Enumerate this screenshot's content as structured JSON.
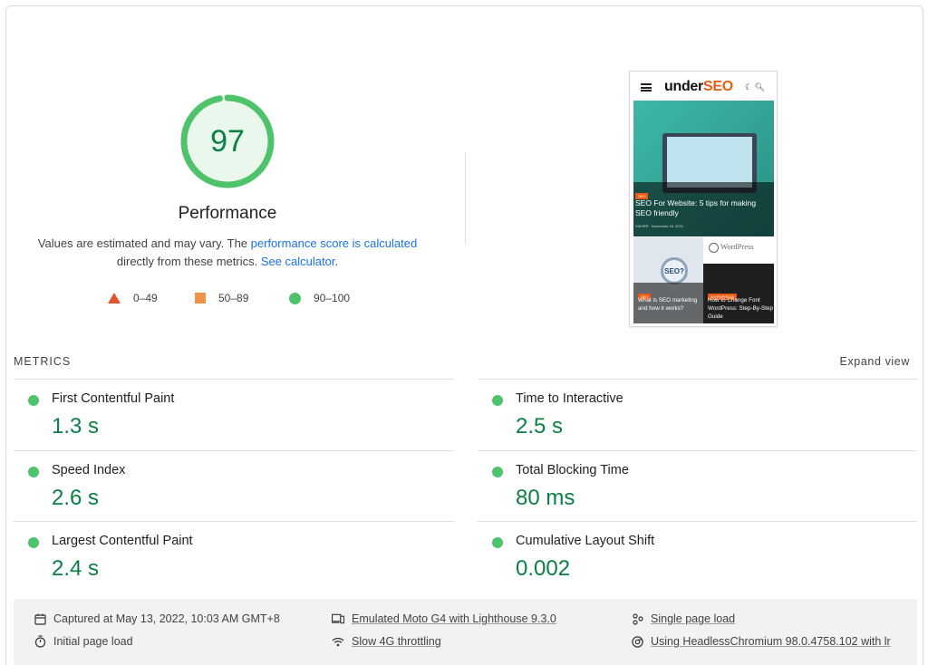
{
  "score": {
    "value": "97",
    "title": "Performance",
    "fraction": 0.97
  },
  "description": {
    "before": "Values are estimated and may vary. The ",
    "link1": "performance score is calculated",
    "middle": "directly from these metrics. ",
    "link2": "See calculator",
    "after": "."
  },
  "legend": [
    {
      "label": "0–49",
      "color": "#e3562c",
      "icon": "triangle-icon"
    },
    {
      "label": "50–89",
      "color": "#f0924a",
      "icon": "square-icon"
    },
    {
      "label": "90–100",
      "color": "#4fc36c",
      "icon": "circle-icon"
    }
  ],
  "thumbnail": {
    "logo_main": "under",
    "logo_accent": "SEO",
    "hero_tag": "SEO",
    "hero_title": "SEO For Website: 5 tips for making SEO friendly",
    "hero_meta": "XAVIER  ·  November 16, 2021",
    "card1_tag": "SEO",
    "card1_badge": "SEO?",
    "card1_title": "What is SEO marketing and how it works?",
    "card2_logo": "WordPress",
    "card2_tag": "WORDPRESS",
    "card2_title": "How to Change Font WordPress: Step-By-Step Guide"
  },
  "metrics": {
    "label": "METRICS",
    "expand": "Expand view",
    "items": [
      {
        "title": "First Contentful Paint",
        "value": "1.3 s"
      },
      {
        "title": "Time to Interactive",
        "value": "2.5 s"
      },
      {
        "title": "Speed Index",
        "value": "2.6 s"
      },
      {
        "title": "Total Blocking Time",
        "value": "80 ms"
      },
      {
        "title": "Largest Contentful Paint",
        "value": "2.4 s"
      },
      {
        "title": "Cumulative Layout Shift",
        "value": "0.002"
      }
    ]
  },
  "footer": {
    "captured": "Captured at May 13, 2022, 10:03 AM GMT+8",
    "initial": "Initial page load",
    "emulated": "Emulated Moto G4 with Lighthouse 9.3.0",
    "throttling": "Slow 4G throttling",
    "single": "Single page load",
    "using": "Using HeadlessChromium 98.0.4758.102 with lr"
  },
  "colors": {
    "pass": "#0b8043",
    "pass_dot": "#4fc36c",
    "link": "#1a73e8",
    "brand_accent": "#e85a12"
  }
}
